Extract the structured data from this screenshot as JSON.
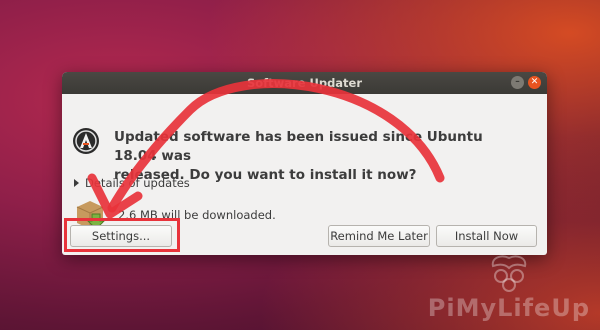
{
  "window": {
    "title": "Software Updater"
  },
  "dialog": {
    "message_line1": "Updated software has been issued since Ubuntu 18.04 was",
    "message_line2": "released. Do you want to install it now?",
    "details_label": "Details of updates",
    "download_text": "2.6 MB will be downloaded."
  },
  "buttons": {
    "settings": "Settings...",
    "remind": "Remind Me Later",
    "install": "Install Now"
  },
  "annotation": {
    "color": "#e8333b"
  },
  "watermark": {
    "text": "PiMyLifeUp"
  },
  "colors": {
    "accent": "#e95420",
    "titlebar": "#3b3a36",
    "dialog_bg": "#f2f1f0"
  }
}
